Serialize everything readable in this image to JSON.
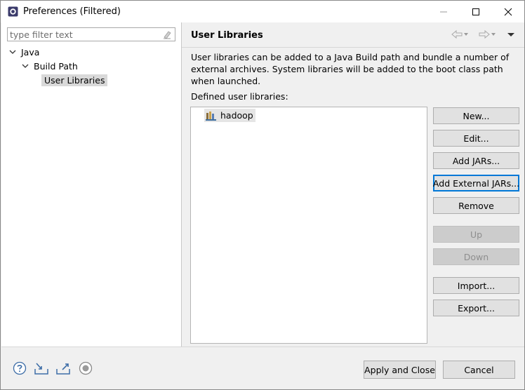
{
  "window": {
    "title": "Preferences (Filtered)"
  },
  "sidebar": {
    "filter_placeholder": "type filter text",
    "tree": [
      {
        "label": "Java"
      },
      {
        "label": "Build Path"
      },
      {
        "label": "User Libraries"
      }
    ]
  },
  "main": {
    "title": "User Libraries",
    "description": "User libraries can be added to a Java Build path and bundle a number of external archives. System libraries will be added to the boot class path when launched.",
    "defined_label": "Defined user libraries:",
    "libraries": [
      {
        "name": "hadoop"
      }
    ],
    "buttons": {
      "new": "New...",
      "edit": "Edit...",
      "add_jars": "Add JARs...",
      "add_external_jars": "Add External JARs...",
      "remove": "Remove",
      "up": "Up",
      "down": "Down",
      "import": "Import...",
      "export": "Export..."
    }
  },
  "footer": {
    "apply_close": "Apply and Close",
    "cancel": "Cancel"
  },
  "colors": {
    "accent": "#0078d7",
    "selection": "#d9d9d9"
  }
}
